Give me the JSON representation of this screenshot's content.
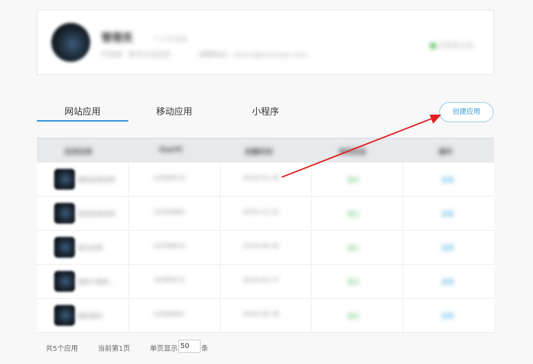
{
  "profile": {
    "name": "管理员",
    "tag": "个人开发者",
    "subtitle": "开发者 · 账号认证状态",
    "email": "邮箱地址：demo@example.com",
    "status": "已实名认证"
  },
  "tabs": [
    {
      "label": "网站应用",
      "active": true
    },
    {
      "label": "移动应用",
      "active": false
    },
    {
      "label": "小程序",
      "active": false
    }
  ],
  "create_button": "创建应用",
  "table": {
    "headers": [
      "应用名称",
      "AppID",
      "创建时间",
      "审核状态",
      "操作"
    ],
    "rows": [
      {
        "name": "我的应用名称",
        "id": "10284570",
        "date": "2018-01-30",
        "status": "通过",
        "action": "查看"
      },
      {
        "name": "测试应用名称",
        "id": "10336883",
        "date": "2019-11-22",
        "status": "通过",
        "action": "查看"
      },
      {
        "name": "演示应用",
        "id": "10796833",
        "date": "2019-08-02",
        "status": "通过",
        "action": "查看"
      },
      {
        "name": "我的小程序...",
        "id": "10589072",
        "date": "2019-02-17",
        "status": "通过",
        "action": "查看"
      },
      {
        "name": "我的演示",
        "id": "10260861",
        "date": "2019-05-30",
        "status": "通过",
        "action": "查看"
      }
    ]
  },
  "footer": {
    "total": "共5个应用",
    "current_page": "当前第1页",
    "page_size_label": "单页显示",
    "page_size_value": "50",
    "unit": "条"
  },
  "colors": {
    "accent": "#2b8fd9",
    "button_text": "#3aa0d8",
    "status_green": "#5cbf64",
    "annotation_arrow": "#e02020"
  },
  "icons": {
    "avatar": "user-avatar",
    "row_icon": "app-icon",
    "status": "green-status-square",
    "annotation": "red-arrow"
  }
}
